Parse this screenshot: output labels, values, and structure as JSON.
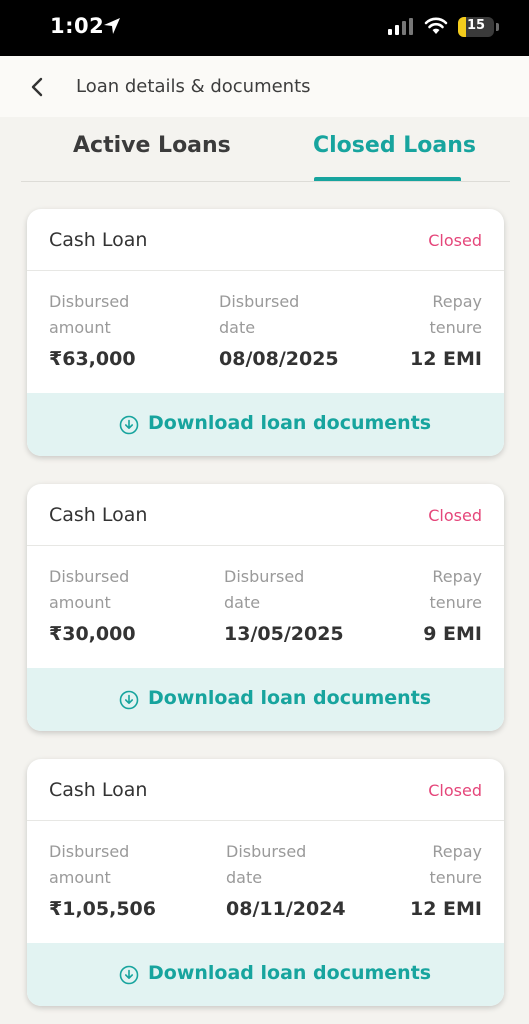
{
  "status_bar": {
    "time": "1:02",
    "battery": "15"
  },
  "header": {
    "title": "Loan details & documents"
  },
  "tabs": [
    {
      "label": "Active Loans",
      "active": false
    },
    {
      "label": "Closed Loans",
      "active": true
    }
  ],
  "loans": [
    {
      "title": "Cash Loan",
      "status": "Closed",
      "amount_label": "Disbursed amount",
      "amount": "₹63,000",
      "date_label": "Disbursed date",
      "date": "08/08/2025",
      "tenure_label": "Repay tenure",
      "tenure": "12 EMI",
      "download_label": "Download loan documents"
    },
    {
      "title": "Cash Loan",
      "status": "Closed",
      "amount_label": "Disbursed amount",
      "amount": "₹30,000",
      "date_label": "Disbursed date",
      "date": "13/05/2025",
      "tenure_label": "Repay tenure",
      "tenure": "9 EMI",
      "download_label": "Download loan documents"
    },
    {
      "title": "Cash Loan",
      "status": "Closed",
      "amount_label": "Disbursed amount",
      "amount": "₹1,05,506",
      "date_label": "Disbursed date",
      "date": "08/11/2024",
      "tenure_label": "Repay tenure",
      "tenure": "12 EMI",
      "download_label": "Download loan documents"
    }
  ],
  "colors": {
    "accent": "#17a49e",
    "status_closed": "#e5467a",
    "download_bg": "#e2f3f2"
  }
}
